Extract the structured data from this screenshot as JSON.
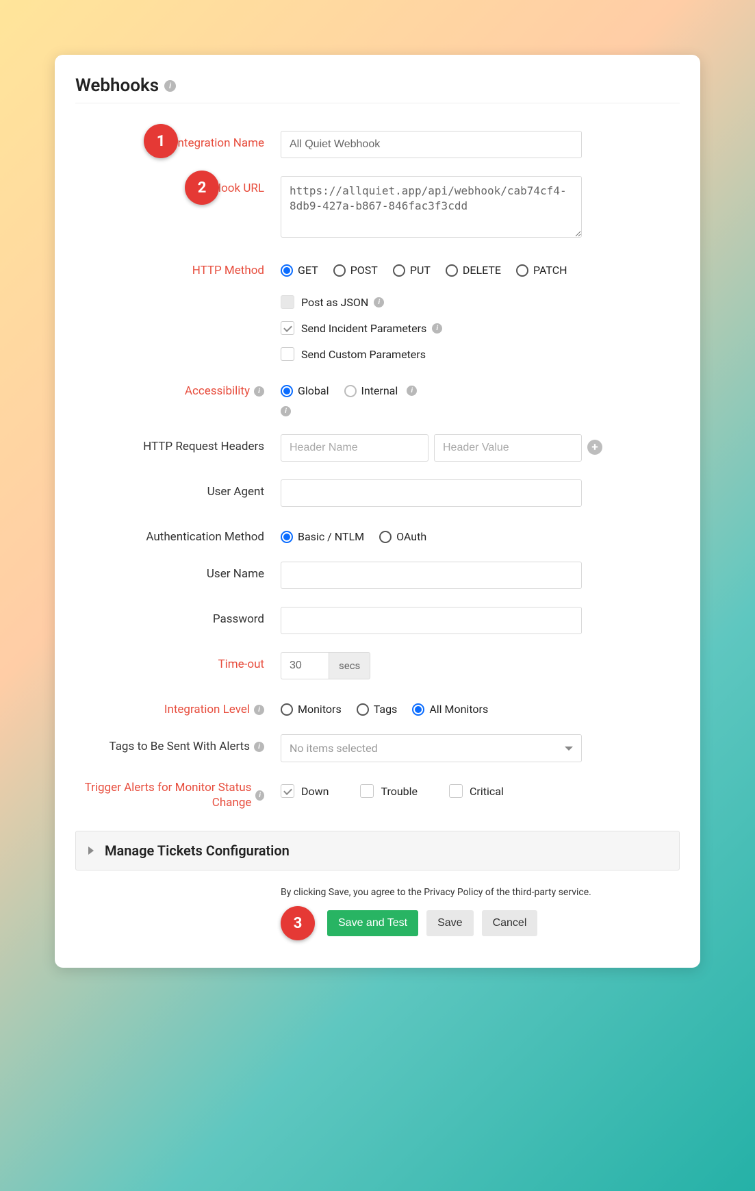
{
  "title": "Webhooks",
  "badges": {
    "one": "1",
    "two": "2",
    "three": "3"
  },
  "labels": {
    "integrationName": "Integration Name",
    "hookUrl": "Hook URL",
    "httpMethod": "HTTP Method",
    "accessibility": "Accessibility",
    "httpHeaders": "HTTP Request Headers",
    "userAgent": "User Agent",
    "authMethod": "Authentication Method",
    "userName": "User Name",
    "password": "Password",
    "timeout": "Time-out",
    "integrationLevel": "Integration Level",
    "tagsToSend": "Tags to Be Sent With Alerts",
    "triggerAlerts": "Trigger Alerts for Monitor Status Change"
  },
  "fields": {
    "integrationName": "All Quiet Webhook",
    "hookUrl": "https://allquiet.app/api/webhook/cab74cf4-8db9-427a-b867-846fac3f3cdd",
    "userAgent": "",
    "userName": "",
    "password": "",
    "timeout": "30",
    "timeoutUnit": "secs"
  },
  "httpMethods": {
    "get": "GET",
    "post": "POST",
    "put": "PUT",
    "delete": "DELETE",
    "patch": "PATCH",
    "selected": "GET"
  },
  "options": {
    "postAsJson": "Post as JSON",
    "sendIncident": "Send Incident Parameters",
    "sendCustom": "Send Custom Parameters"
  },
  "accessibility": {
    "global": "Global",
    "internal": "Internal",
    "selected": "Global"
  },
  "headers": {
    "namePlaceholder": "Header Name",
    "valuePlaceholder": "Header Value"
  },
  "authMethods": {
    "basic": "Basic / NTLM",
    "oauth": "OAuth",
    "selected": "Basic / NTLM"
  },
  "integrationLevel": {
    "monitors": "Monitors",
    "tags": "Tags",
    "all": "All Monitors",
    "selected": "All Monitors"
  },
  "tagsDropdown": "No items selected",
  "triggers": {
    "down": "Down",
    "trouble": "Trouble",
    "critical": "Critical"
  },
  "accordion": "Manage Tickets Configuration",
  "disclaimer": "By clicking Save, you agree to the Privacy Policy of the third-party service.",
  "buttons": {
    "saveTest": "Save and Test",
    "save": "Save",
    "cancel": "Cancel"
  },
  "icons": {
    "info": "i",
    "plus": "+"
  }
}
